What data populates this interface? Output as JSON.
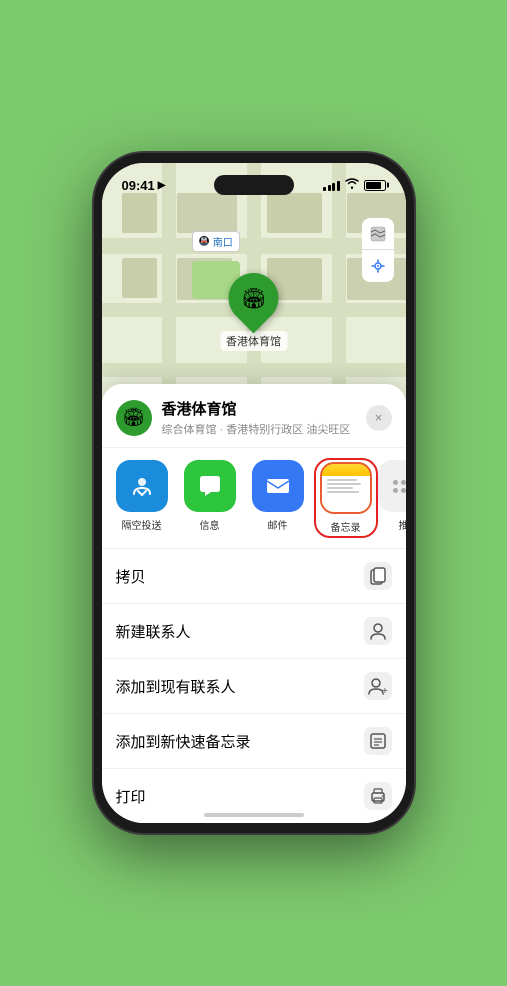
{
  "status_bar": {
    "time": "09:41",
    "navigation_icon": "▶"
  },
  "map": {
    "place_label": "南口",
    "place_label_prefix": "地铁"
  },
  "location_pin": {
    "label": "香港体育馆"
  },
  "map_controls": {
    "map_type_icon": "🗺",
    "location_icon": "↗"
  },
  "place_header": {
    "name": "香港体育馆",
    "subtitle": "综合体育馆 · 香港特别行政区 油尖旺区",
    "close_label": "×"
  },
  "share_items": [
    {
      "id": "airdrop",
      "label": "隔空投送",
      "icon": "📡",
      "class": "airdrop"
    },
    {
      "id": "messages",
      "label": "信息",
      "icon": "💬",
      "class": "messages"
    },
    {
      "id": "mail",
      "label": "邮件",
      "icon": "✉",
      "class": "mail"
    },
    {
      "id": "notes",
      "label": "备忘录",
      "icon": "",
      "class": "notes"
    },
    {
      "id": "more",
      "label": "推",
      "icon": "",
      "class": "more"
    }
  ],
  "action_rows": [
    {
      "id": "copy",
      "label": "拷贝",
      "icon": "⧉"
    },
    {
      "id": "new-contact",
      "label": "新建联系人",
      "icon": "👤"
    },
    {
      "id": "add-existing",
      "label": "添加到现有联系人",
      "icon": "👤+"
    },
    {
      "id": "add-notes",
      "label": "添加到新快速备忘录",
      "icon": "📋"
    },
    {
      "id": "print",
      "label": "打印",
      "icon": "🖨"
    }
  ]
}
